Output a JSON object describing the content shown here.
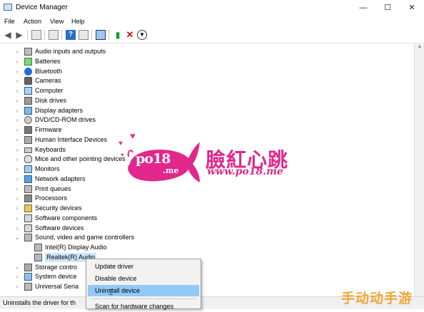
{
  "window": {
    "title": "Device Manager",
    "controls": [
      "—",
      "☐",
      "✕"
    ]
  },
  "menu": [
    "File",
    "Action",
    "View",
    "Help"
  ],
  "tree": [
    {
      "label": "Audio inputs and outputs",
      "icon": "speaker-icon",
      "expanded": false
    },
    {
      "label": "Batteries",
      "icon": "battery-icon",
      "expanded": false
    },
    {
      "label": "Bluetooth",
      "icon": "bluetooth-icon",
      "expanded": false
    },
    {
      "label": "Cameras",
      "icon": "camera-icon",
      "expanded": false
    },
    {
      "label": "Computer",
      "icon": "computer-icon",
      "expanded": false
    },
    {
      "label": "Disk drives",
      "icon": "disk-icon",
      "expanded": false
    },
    {
      "label": "Display adapters",
      "icon": "display-icon",
      "expanded": false
    },
    {
      "label": "DVD/CD-ROM drives",
      "icon": "dvd-icon",
      "expanded": false
    },
    {
      "label": "Firmware",
      "icon": "chip-icon",
      "expanded": false
    },
    {
      "label": "Human Interface Devices",
      "icon": "hid-icon",
      "expanded": false
    },
    {
      "label": "Keyboards",
      "icon": "keyboard-icon",
      "expanded": false
    },
    {
      "label": "Mice and other pointing devices",
      "icon": "mouse-icon",
      "expanded": false
    },
    {
      "label": "Monitors",
      "icon": "monitor-icon",
      "expanded": false
    },
    {
      "label": "Network adapters",
      "icon": "network-icon",
      "expanded": false
    },
    {
      "label": "Print queues",
      "icon": "printer-icon",
      "expanded": false
    },
    {
      "label": "Processors",
      "icon": "processor-icon",
      "expanded": false
    },
    {
      "label": "Security devices",
      "icon": "security-icon",
      "expanded": false
    },
    {
      "label": "Software components",
      "icon": "component-icon",
      "expanded": false
    },
    {
      "label": "Software devices",
      "icon": "component-icon",
      "expanded": false
    },
    {
      "label": "Sound, video and game controllers",
      "icon": "speaker-icon",
      "expanded": true
    },
    {
      "label": "Intel(R) Display Audio",
      "icon": "speaker-icon",
      "child": true
    },
    {
      "label": "Realtek(R) Audio",
      "icon": "speaker-icon",
      "child": true,
      "selected": true
    },
    {
      "label": "Storage contro",
      "icon": "storage-icon",
      "expanded": false
    },
    {
      "label": "System device",
      "icon": "system-icon",
      "expanded": false
    },
    {
      "label": "Universal Seria",
      "icon": "usb-icon",
      "expanded": false
    }
  ],
  "context_menu": {
    "items": [
      "Update driver",
      "Disable device",
      "Uninstall device",
      "Scan for hardware changes"
    ],
    "highlighted": "Uninstall device"
  },
  "status": "Uninstalls the driver for th",
  "watermark": {
    "logo": "po18.me",
    "chinese": "臉紅心跳",
    "url": "www.po18.me",
    "corner": "手动动手游"
  },
  "colors": {
    "watermark_pink": "#e3268b",
    "selection": "#cce8ff",
    "menu_highlight": "#91c9f7",
    "corner_text": "#f0a838"
  }
}
